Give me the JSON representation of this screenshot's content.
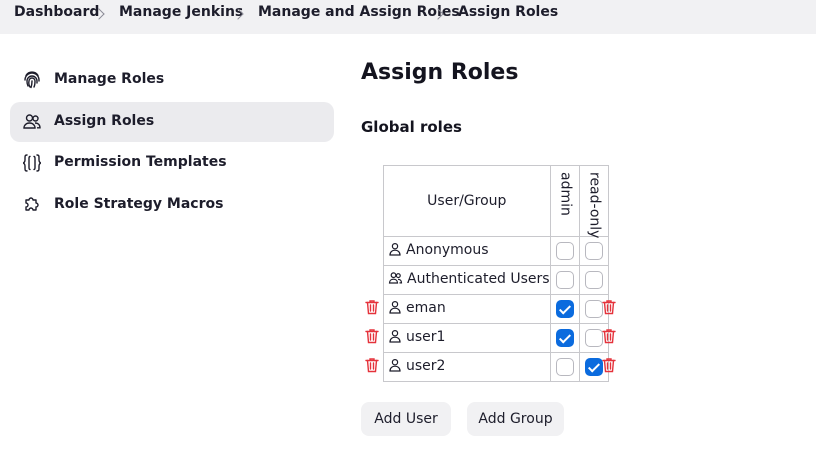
{
  "breadcrumb": [
    "Dashboard",
    "Manage Jenkins",
    "Manage and Assign Roles",
    "Assign Roles"
  ],
  "sidebar": {
    "items": [
      {
        "label": "Manage Roles",
        "icon": "fingerprint-icon",
        "active": false
      },
      {
        "label": "Assign Roles",
        "icon": "users-icon",
        "active": true
      },
      {
        "label": "Permission Templates",
        "icon": "braces-icon",
        "active": false
      },
      {
        "label": "Role Strategy Macros",
        "icon": "puzzle-icon",
        "active": false
      }
    ]
  },
  "main": {
    "title": "Assign Roles",
    "section_title": "Global roles",
    "table": {
      "user_header": "User/Group",
      "roles": [
        "admin",
        "read-only"
      ],
      "rows": [
        {
          "name": "Anonymous",
          "type": "user",
          "admin": false,
          "read_only": false,
          "deletable": false
        },
        {
          "name": "Authenticated Users",
          "type": "group",
          "admin": false,
          "read_only": false,
          "deletable": false
        },
        {
          "name": "eman",
          "type": "user",
          "admin": true,
          "read_only": false,
          "deletable": true
        },
        {
          "name": "user1",
          "type": "user",
          "admin": true,
          "read_only": false,
          "deletable": true
        },
        {
          "name": "user2",
          "type": "user",
          "admin": false,
          "read_only": true,
          "deletable": true
        }
      ]
    },
    "add_user_label": "Add User",
    "add_group_label": "Add Group"
  },
  "colors": {
    "accent": "#0b6bde",
    "delete": "#e5323b",
    "active_bg": "#ebebee"
  }
}
